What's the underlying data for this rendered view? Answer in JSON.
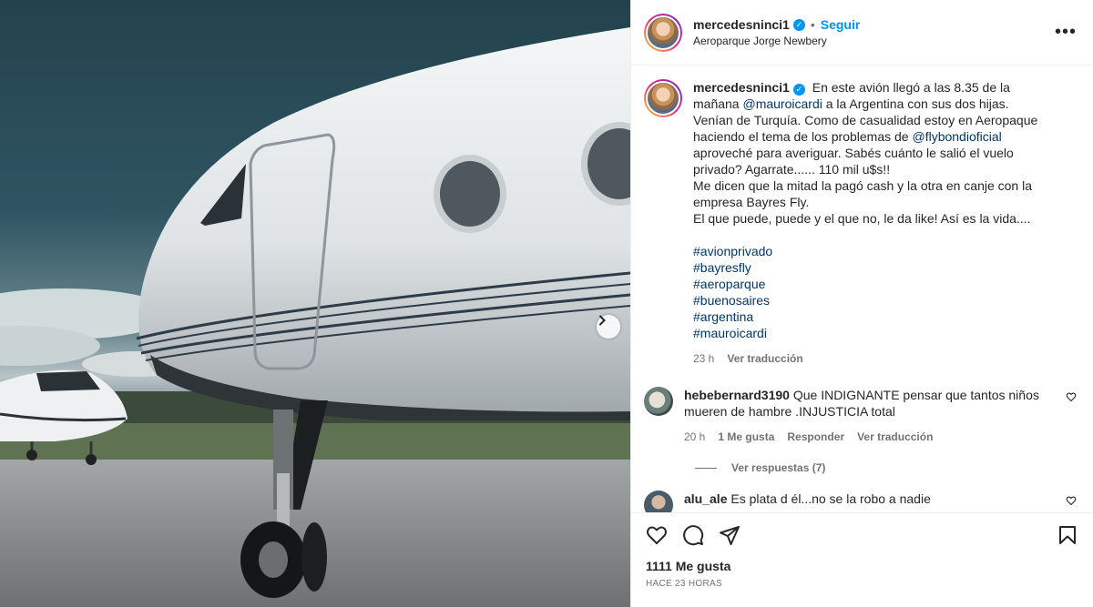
{
  "post": {
    "username": "mercedesninci1",
    "follow_label": "Seguir",
    "location": "Aeroparque Jorge Newbery",
    "more_label": "•••"
  },
  "caption": {
    "username": "mercedesninci1",
    "text_1": "En este avión llegó a las 8.35 de la mañana",
    "mention_1": "@mauroicardi",
    "text_2": "a la Argentina con sus dos hijas. Venían de Turquía. Como de casualidad estoy en Aeropaque haciendo el tema de los problemas de",
    "mention_2": "@flybondioficial",
    "text_3": "aproveché para averiguar. Sabés cuánto le salió el vuelo privado? Agarrate...... 110 mil u$s!!",
    "text_4": "Me dicen que la mitad la pagó cash y la otra en canje con la empresa Bayres Fly.",
    "text_5": "El que puede, puede y el que no, le da like! Así es la vida....",
    "hashtags": [
      "#avionprivado",
      "#bayresfly",
      "#aeroparque",
      "#buenosaires",
      "#argentina",
      "#mauroicardi"
    ],
    "time": "23 h",
    "translate": "Ver traducción"
  },
  "comments": [
    {
      "username": "hebebernard3190",
      "text": "Que INDIGNANTE pensar que tantos niños mueren de hambre .INJUSTICIA total",
      "time": "20 h",
      "likes": "1 Me gusta",
      "reply": "Responder",
      "translate": "Ver traducción",
      "replies": "Ver respuestas (7)"
    },
    {
      "username": "alu_ale",
      "text": "Es plata d él...no se la robo a nadie"
    }
  ],
  "footer": {
    "likes": "1111 Me gusta",
    "ago": "HACE 23 HORAS"
  },
  "icons": [
    "heart-icon",
    "comment-icon",
    "share-icon",
    "save-icon",
    "chevron-right-icon",
    "verified-icon"
  ],
  "colors": {
    "accent": "#0095f6",
    "link": "#00376b",
    "muted": "#737373"
  }
}
